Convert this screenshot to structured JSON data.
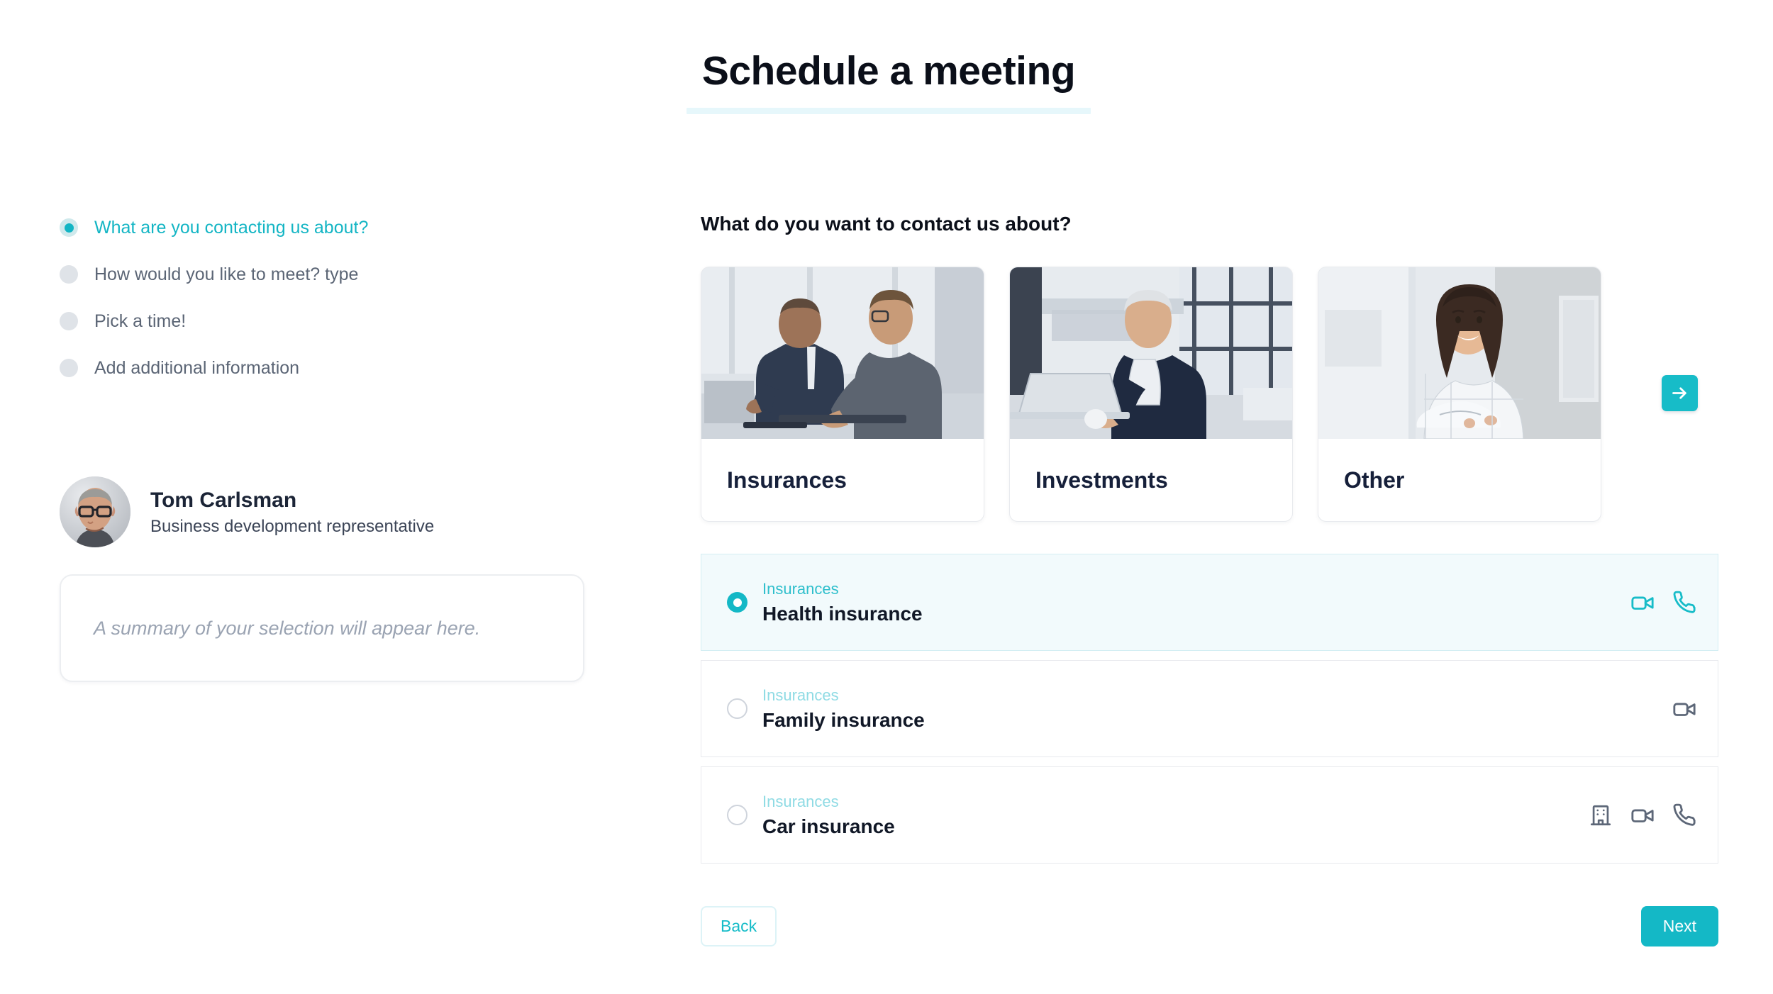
{
  "header": {
    "title": "Schedule a meeting",
    "accent_color": "#14b8c6",
    "underline_color": "#e6f7fb"
  },
  "sidebar": {
    "steps": [
      {
        "label": "What are you contacting us about?",
        "state": "active"
      },
      {
        "label": "How would you like to meet? type",
        "state": "inactive"
      },
      {
        "label": "Pick a time!",
        "state": "inactive"
      },
      {
        "label": "Add additional information",
        "state": "inactive"
      }
    ],
    "profile": {
      "name": "Tom Carlsman",
      "role": "Business development representative",
      "avatar_icon": "user-photo-avatar"
    },
    "summary": {
      "placeholder": "A summary of your selection will appear here."
    }
  },
  "main": {
    "question": "What do you want to contact us about?",
    "categories": [
      {
        "label": "Insurances",
        "photo": "two-men-meeting-photo"
      },
      {
        "label": "Investments",
        "photo": "man-with-laptop-photo"
      },
      {
        "label": "Other",
        "photo": "woman-arms-crossed-photo"
      }
    ],
    "carousel_next_icon": "arrow-right-icon",
    "options": [
      {
        "category": "Insurances",
        "title": "Health insurance",
        "selected": true,
        "icons": [
          "video-camera-icon",
          "phone-icon"
        ]
      },
      {
        "category": "Insurances",
        "title": "Family insurance",
        "selected": false,
        "icons": [
          "video-camera-icon"
        ]
      },
      {
        "category": "Insurances",
        "title": "Car insurance",
        "selected": false,
        "icons": [
          "office-building-icon",
          "video-camera-icon",
          "phone-icon"
        ]
      }
    ],
    "footer": {
      "back_label": "Back",
      "next_label": "Next"
    }
  }
}
